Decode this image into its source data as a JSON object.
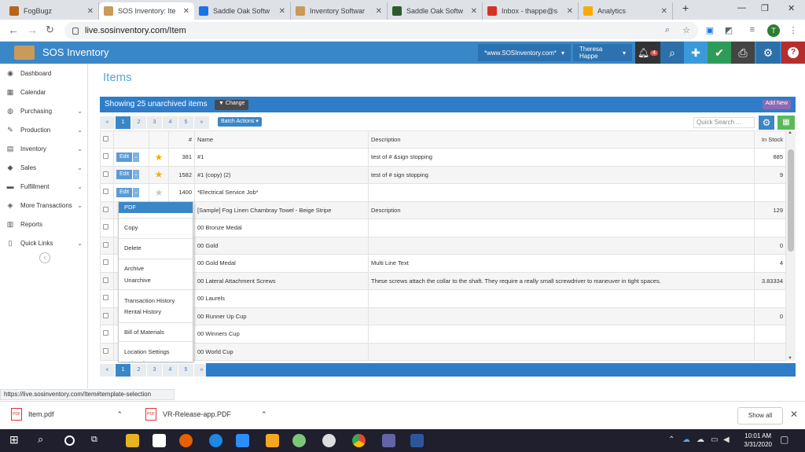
{
  "browser": {
    "tabs": [
      {
        "label": "FogBugz",
        "icon": "fogbugz-icon",
        "color": "#b5651d"
      },
      {
        "label": "SOS Inventory: Ite",
        "icon": "sos-icon",
        "color": "#c99a5a",
        "active": true
      },
      {
        "label": "Saddle Oak Softw",
        "icon": "calendar-31-icon",
        "color": "#1a73e8"
      },
      {
        "label": "Inventory Softwar",
        "icon": "sos-icon",
        "color": "#c99a5a"
      },
      {
        "label": "Saddle Oak Softw",
        "icon": "shield-icon",
        "color": "#2d5a2d"
      },
      {
        "label": "Inbox - thappe@s",
        "icon": "gmail-icon",
        "color": "#d93025"
      },
      {
        "label": "Analytics",
        "icon": "analytics-icon",
        "color": "#f9ab00"
      }
    ],
    "new_tab": "+",
    "url": "live.sosinventory.com/Item",
    "profile_initial": "T"
  },
  "app": {
    "name": "SOS Inventory",
    "site_select": "*www.SOSInventory.com*",
    "user_select": "Theresa Happe",
    "notification_count": "4"
  },
  "sidebar": {
    "items": [
      {
        "label": "Dashboard",
        "icon": "dashboard-icon",
        "chev": false
      },
      {
        "label": "Calendar",
        "icon": "calendar-icon",
        "chev": false
      },
      {
        "label": "Purchasing",
        "icon": "globe-icon",
        "chev": true
      },
      {
        "label": "Production",
        "icon": "wrench-icon",
        "chev": true
      },
      {
        "label": "Inventory",
        "icon": "inventory-icon",
        "chev": true
      },
      {
        "label": "Sales",
        "icon": "tag-icon",
        "chev": true
      },
      {
        "label": "Fulfillment",
        "icon": "truck-icon",
        "chev": true
      },
      {
        "label": "More Transactions",
        "icon": "transactions-icon",
        "chev": true
      },
      {
        "label": "Reports",
        "icon": "reports-icon",
        "chev": false
      },
      {
        "label": "Quick Links",
        "icon": "bookmark-icon",
        "chev": true
      }
    ]
  },
  "main": {
    "title": "Items",
    "showing": "Showing 25 unarchived items",
    "change_label": "Change",
    "add_new_label": "Add New",
    "pages": [
      "«",
      "1",
      "2",
      "3",
      "4",
      "5",
      "»"
    ],
    "current_page": "1",
    "batch_actions": "Batch Actions",
    "quick_search_placeholder": "Quick Search ...",
    "columns": [
      "",
      "",
      "",
      "#",
      "Name",
      "Description",
      "In Stock"
    ],
    "edit_label": "Edit",
    "rows": [
      {
        "num": "381",
        "name": "#1",
        "desc": "test of # &sign stopping",
        "stock": "885",
        "star": "gold"
      },
      {
        "num": "1582",
        "name": "#1 (copy) (2)",
        "desc": "test of # sign stopping",
        "stock": "9",
        "star": "gold"
      },
      {
        "num": "1400",
        "name": "*Electrical Service Job*",
        "desc": "",
        "stock": "",
        "star": "grey"
      },
      {
        "num": "",
        "name": "[Sample] Fog Linen Chambray Towel - Beige Stripe",
        "desc": "Description",
        "stock": "129",
        "star": ""
      },
      {
        "num": "",
        "name": "00 Bronze Medal",
        "desc": "",
        "stock": "",
        "star": ""
      },
      {
        "num": "",
        "name": "00 Gold",
        "desc": "",
        "stock": "0",
        "star": ""
      },
      {
        "num": "",
        "name": "00 Gold Medal",
        "desc": "Multi Line Text",
        "stock": "4",
        "star": ""
      },
      {
        "num": "",
        "name": "00 Lateral Attachment Screws",
        "desc": "These screws attach the collar to the shaft. They require a really small screwdriver to maneuver in tight spaces.",
        "stock": "3.83334",
        "star": ""
      },
      {
        "num": "",
        "name": "00 Laurels",
        "desc": "",
        "stock": "",
        "star": ""
      },
      {
        "num": "",
        "name": "00 Runner Up Cup",
        "desc": "",
        "stock": "0",
        "star": ""
      },
      {
        "num": "",
        "name": "00 Winners Cup",
        "desc": "",
        "stock": "",
        "star": ""
      },
      {
        "num": "",
        "name": "00 World Cup",
        "desc": "",
        "stock": "",
        "star": ""
      },
      {
        "num": "",
        "name": "",
        "desc": "",
        "stock": "",
        "star": ""
      }
    ],
    "dropdown": [
      "PDF",
      "Copy",
      "Delete",
      "Archive",
      "Unarchive",
      "Transaction History",
      "Rental History",
      "Bill of Materials",
      "Location Settings",
      "Units of Measure"
    ]
  },
  "status_url": "https://live.sosinventory.com/Item#template-selection",
  "downloads": [
    {
      "name": "Item.pdf"
    },
    {
      "name": "VR-Release-app.PDF"
    }
  ],
  "show_all": "Show all",
  "taskbar": {
    "time": "10:01 AM",
    "date": "3/31/2020"
  }
}
